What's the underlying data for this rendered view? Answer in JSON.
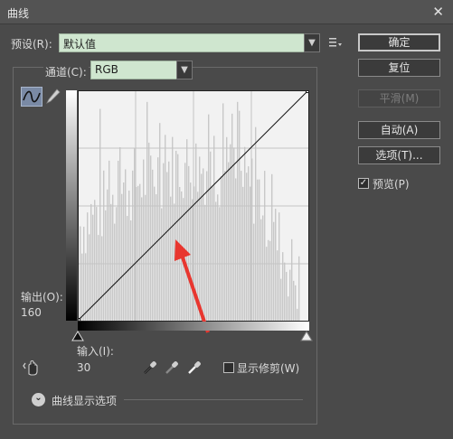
{
  "window": {
    "title": "曲线",
    "close_glyph": "✕"
  },
  "preset": {
    "label": "预设(R):",
    "value": "默认值"
  },
  "channel": {
    "label": "通道(C):",
    "value": "RGB"
  },
  "output": {
    "label": "输出(O):",
    "value": "160"
  },
  "input": {
    "label": "输入(I):",
    "value": "30"
  },
  "buttons": {
    "ok": "确定",
    "reset": "复位",
    "smooth": "平滑(M)",
    "auto": "自动(A)",
    "options": "选项(T)..."
  },
  "preview": {
    "label": "预览(P)",
    "checked": true,
    "check_glyph": "✓"
  },
  "show_clipping": {
    "label": "显示修剪(W)",
    "checked": false
  },
  "curve_options": {
    "label": "曲线显示选项",
    "glyph": "⌄"
  },
  "curve": {
    "points": [
      [
        0,
        0
      ],
      [
        255,
        255
      ]
    ]
  },
  "colors": {
    "annotation_arrow": "#e8362f",
    "histogram": "#c8c8c8",
    "graph_bg": "#f2f2f2"
  },
  "icons": [
    "close-icon",
    "preset-menu-icon",
    "curve-edit-tool-icon",
    "pencil-tool-icon",
    "black-point-eyedropper-icon",
    "gray-point-eyedropper-icon",
    "white-point-eyedropper-icon",
    "targeted-adjust-hand-icon",
    "expand-toggle-icon"
  ]
}
